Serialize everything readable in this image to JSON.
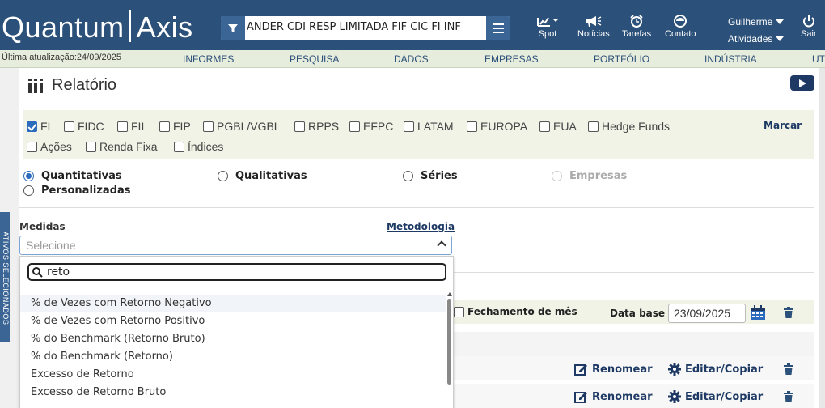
{
  "header": {
    "logo_left": "Quantum",
    "logo_right": "Axis",
    "fund_selector": "ANDER CDI RESP LIMITADA FIF CIC FI INF",
    "nav": [
      {
        "label": "Spot",
        "icon": "spot-chart-icon"
      },
      {
        "label": "Notícias",
        "icon": "megaphone-icon"
      },
      {
        "label": "Tarefas",
        "icon": "alarm-clock-icon"
      },
      {
        "label": "Contato",
        "icon": "contact-icon"
      }
    ],
    "user": "Guilherme",
    "activities": "Atividades",
    "logout": "Sair"
  },
  "subbar": {
    "last_update": "Última atualização:24/09/2025",
    "menu": [
      "INFORMES",
      "PESQUISA",
      "DADOS",
      "EMPRESAS",
      "PORTFÓLIO",
      "INDÚSTRIA",
      "UT"
    ]
  },
  "page": {
    "title": "Relatório",
    "side_tab": "ATIVOS SELECIONADOS",
    "marcar": "Marcar"
  },
  "fund_types": [
    {
      "label": "FI",
      "checked": true
    },
    {
      "label": "FIDC",
      "checked": false
    },
    {
      "label": "FII",
      "checked": false
    },
    {
      "label": "FIP",
      "checked": false
    },
    {
      "label": "PGBL/VGBL",
      "checked": false
    },
    {
      "label": "RPPS",
      "checked": false
    },
    {
      "label": "EFPC",
      "checked": false
    },
    {
      "label": "LATAM",
      "checked": false
    },
    {
      "label": "EUROPA",
      "checked": false
    },
    {
      "label": "EUA",
      "checked": false
    },
    {
      "label": "Hedge Funds",
      "checked": false
    },
    {
      "label": "Ações",
      "checked": false
    },
    {
      "label": "Renda Fixa",
      "checked": false
    },
    {
      "label": "Índices",
      "checked": false
    }
  ],
  "report_types": [
    {
      "label": "Quantitativas",
      "selected": true,
      "disabled": false
    },
    {
      "label": "Qualitativas",
      "selected": false,
      "disabled": false
    },
    {
      "label": "Séries",
      "selected": false,
      "disabled": false
    },
    {
      "label": "Empresas",
      "selected": false,
      "disabled": true
    },
    {
      "label": "Personalizadas",
      "selected": false,
      "disabled": false
    }
  ],
  "measures": {
    "label": "Medidas",
    "methodology": "Metodologia",
    "placeholder": "Selecione",
    "search_value": "reto",
    "options": [
      "% de Vezes com Retorno Negativo",
      "% de Vezes com Retorno Positivo",
      "% do Benchmark (Retorno Bruto)",
      "% do Benchmark (Retorno)",
      "Excesso de Retorno",
      "Excesso de Retorno Bruto"
    ]
  },
  "right_panel": {
    "month_close": "Fechamento de mês",
    "base_date_label": "Data base",
    "base_date": "23/09/2025",
    "rename": "Renomear",
    "edit_copy": "Editar/Copiar"
  },
  "colors": {
    "header_bg": "#2b5079",
    "subbar_bg": "#e7eddc",
    "accent": "#2b6bbd",
    "link": "#1e3a64"
  }
}
